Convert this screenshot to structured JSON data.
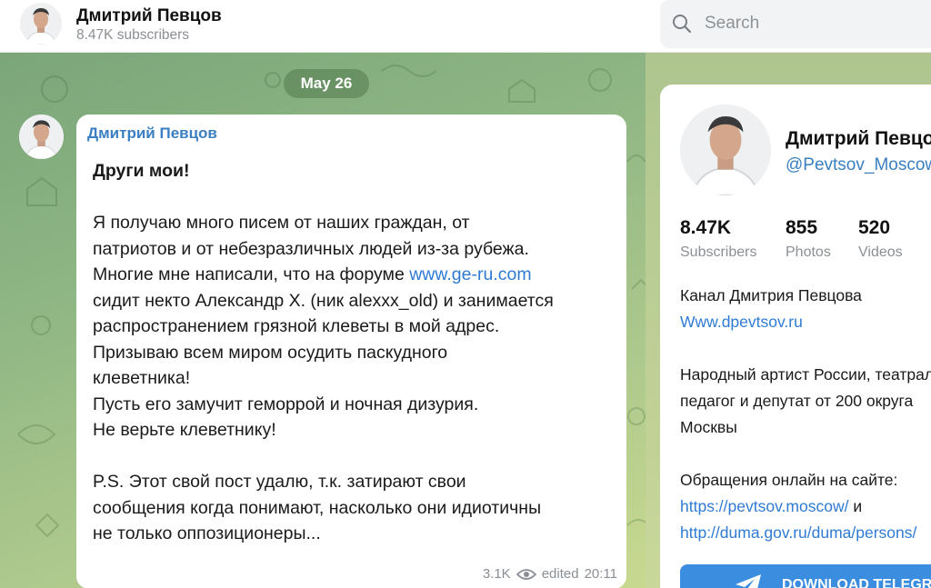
{
  "header": {
    "title": "Дмитрий Певцов",
    "subtitle": "8.47K subscribers"
  },
  "search": {
    "placeholder": "Search"
  },
  "chat": {
    "date": "May 26",
    "message": {
      "author": "Дмитрий Певцов",
      "lines": {
        "l1": "Други мои!",
        "l2": "Я получаю много писем от наших граждан, от",
        "l3": "патриотов и от небезразличных людей из-за рубежа.",
        "l4_text": "Многие мне написали, что на форуме ",
        "l4_link": "www.ge-ru.com",
        "l5": "сидит некто Александр Х. (ник alexxx_old) и занимается",
        "l6": "распространением грязной клеветы в мой адрес.",
        "l7": "Призываю всем миром осудить паскудного",
        "l8": "клеветника!",
        "l9": "Пусть его замучит геморрой и ночная дизурия.",
        "l10": "Не верьте клеветнику!",
        "l11": "P.S. Этот свой пост удалю, т.к. затирают свои",
        "l12": "сообщения когда понимают, насколько они идиотичны",
        "l13": "не только оппозиционеры..."
      },
      "views": "3.1K",
      "edited": "edited",
      "time": "20:11"
    }
  },
  "panel": {
    "name": "Дмитрий Певцов",
    "handle": "@Pevtsov_Moscow",
    "stats": [
      {
        "value": "8.47K",
        "label": "Subscribers"
      },
      {
        "value": "855",
        "label": "Photos"
      },
      {
        "value": "520",
        "label": "Videos"
      }
    ],
    "desc1": "Канал Дмитрия Певцова",
    "desc_link": "Www.dpevtsov.ru",
    "desc2": "Народный артист России, театрал,",
    "desc3": "педагог и депутат от 200 округа",
    "desc4": "Москвы",
    "desc5": "Обращения онлайн на сайте:",
    "link1": "https://pevtsov.moscow/",
    "link1_suffix": " и",
    "link2": "http://duma.gov.ru/duma/persons/",
    "download_label": "DOWNLOAD TELEGRAM"
  },
  "colors": {
    "accent": "#3a7fc1",
    "link": "#2f7bd3",
    "button": "#3b8de0"
  }
}
